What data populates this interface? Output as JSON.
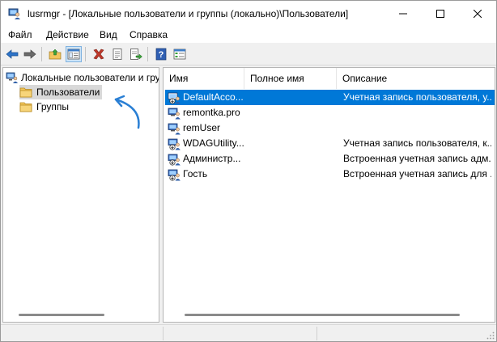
{
  "window": {
    "title": "lusrmgr - [Локальные пользователи и группы (локально)\\Пользователи]"
  },
  "menu": {
    "items": [
      "Файл",
      "Действие",
      "Вид",
      "Справка"
    ]
  },
  "toolbar": {
    "buttons": [
      "back-icon",
      "forward-icon",
      "folder-up-icon",
      "show-tree-icon",
      "delete-icon",
      "properties-icon",
      "export-icon",
      "help-icon",
      "view-icon"
    ]
  },
  "tree": {
    "root_label": "Локальные пользователи и гру",
    "items": [
      {
        "label": "Пользователи",
        "selected": true
      },
      {
        "label": "Группы",
        "selected": false
      }
    ]
  },
  "list": {
    "columns": [
      "Имя",
      "Полное имя",
      "Описание"
    ],
    "rows": [
      {
        "name": "DefaultAcco...",
        "full_name": "",
        "description": "Учетная запись пользователя, у...",
        "selected": true,
        "disabled": true
      },
      {
        "name": "remontka.pro",
        "full_name": "",
        "description": "",
        "selected": false,
        "disabled": false
      },
      {
        "name": "remUser",
        "full_name": "",
        "description": "",
        "selected": false,
        "disabled": false
      },
      {
        "name": "WDAGUtility...",
        "full_name": "",
        "description": "Учетная запись пользователя, к...",
        "selected": false,
        "disabled": true
      },
      {
        "name": "Администр...",
        "full_name": "",
        "description": "Встроенная учетная запись адм...",
        "selected": false,
        "disabled": true
      },
      {
        "name": "Гость",
        "full_name": "",
        "description": "Встроенная учетная запись для ...",
        "selected": false,
        "disabled": true
      }
    ]
  },
  "colors": {
    "selection": "#0078d7",
    "annotation_arrow": "#2a7fd4",
    "folder": "#f2c55c"
  }
}
